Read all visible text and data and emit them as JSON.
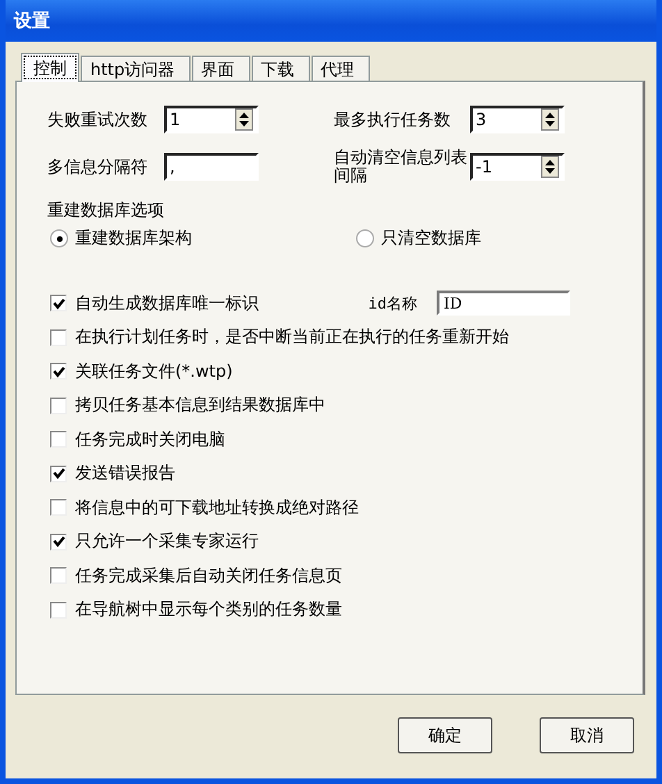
{
  "window": {
    "title": "设置"
  },
  "tabs": [
    {
      "label": "控制",
      "selected": true
    },
    {
      "label": "http访问器",
      "selected": false
    },
    {
      "label": "界面",
      "selected": false
    },
    {
      "label": "下载",
      "selected": false
    },
    {
      "label": "代理",
      "selected": false
    }
  ],
  "fields": [
    {
      "label": "失败重试次数",
      "value": "1",
      "kind": "spin"
    },
    {
      "label": "最多执行任务数",
      "value": "3",
      "kind": "spin"
    },
    {
      "label": "多信息分隔符",
      "value": ",",
      "kind": "text"
    },
    {
      "label": "自动清空信息列表间隔",
      "value": "-1",
      "kind": "spin"
    }
  ],
  "rebuild": {
    "title": "重建数据库选项",
    "options": [
      {
        "label": "重建数据库架构",
        "selected": true
      },
      {
        "label": "只清空数据库",
        "selected": false
      }
    ]
  },
  "options": [
    {
      "label": "自动生成数据库唯一标识",
      "checked": true,
      "field": {
        "label": "id名称",
        "value": "ID"
      }
    },
    {
      "label": "在执行计划任务时，是否中断当前正在执行的任务重新开始",
      "checked": false
    },
    {
      "label": "关联任务文件(*.wtp)",
      "checked": true
    },
    {
      "label": "拷贝任务基本信息到结果数据库中",
      "checked": false
    },
    {
      "label": "任务完成时关闭电脑",
      "checked": false
    },
    {
      "label": "发送错误报告",
      "checked": true
    },
    {
      "label": "将信息中的可下载地址转换成绝对路径",
      "checked": false
    },
    {
      "label": "只允许一个采集专家运行",
      "checked": true
    },
    {
      "label": "任务完成采集后自动关闭任务信息页",
      "checked": false
    },
    {
      "label": "在导航树中显示每个类别的任务数量",
      "checked": false
    }
  ],
  "buttons": [
    "确定",
    "取消"
  ]
}
